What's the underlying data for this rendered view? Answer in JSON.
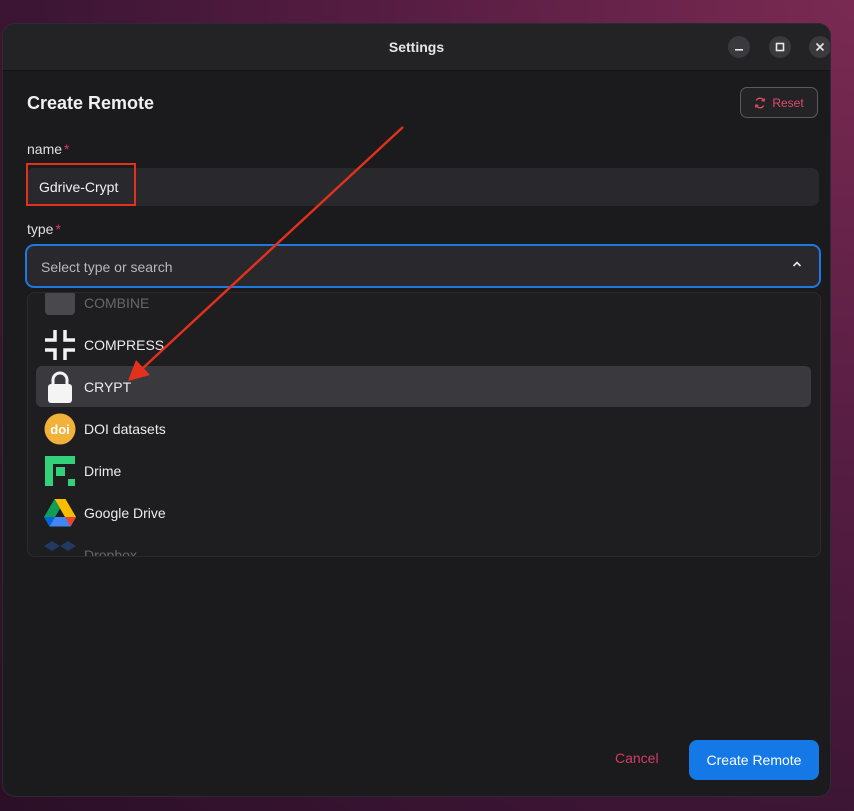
{
  "window": {
    "title": "Settings"
  },
  "form": {
    "heading": "Create Remote",
    "reset_label": "Reset",
    "name_label": "name",
    "required_mark": "*",
    "name_value": "Gdrive-Crypt",
    "type_label": "type",
    "type_placeholder": "Select type or search"
  },
  "dropdown": {
    "items": [
      {
        "label": "COMBINE",
        "icon": "combine-icon"
      },
      {
        "label": "COMPRESS",
        "icon": "compress-icon"
      },
      {
        "label": "CRYPT",
        "icon": "lock-icon",
        "selected": true
      },
      {
        "label": "DOI datasets",
        "icon": "doi-icon"
      },
      {
        "label": "Drime",
        "icon": "drime-icon"
      },
      {
        "label": "Google Drive",
        "icon": "google-drive-icon"
      },
      {
        "label": "Dropbox",
        "icon": "dropbox-icon"
      }
    ]
  },
  "footer": {
    "cancel_label": "Cancel",
    "create_label": "Create Remote"
  },
  "colors": {
    "accent": "#1478e6",
    "danger": "#d23c62",
    "annotation": "#e3311c"
  }
}
